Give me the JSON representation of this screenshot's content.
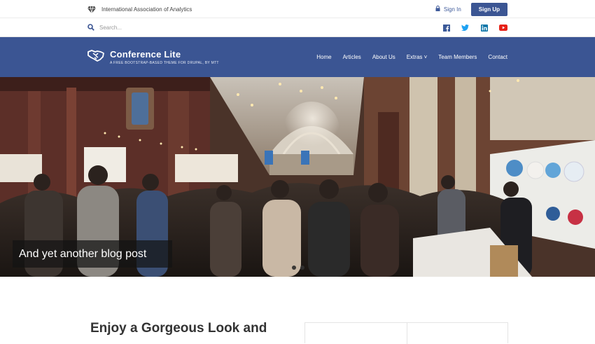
{
  "topbar": {
    "org_name": "International Association of Analytics",
    "signin_label": "Sign In",
    "signup_label": "Sign Up"
  },
  "search": {
    "placeholder": "Search..."
  },
  "social": {
    "icons": [
      "facebook-icon",
      "twitter-icon",
      "linkedin-icon",
      "youtube-icon"
    ],
    "colors": {
      "facebook": "#3b5998",
      "twitter": "#1da1f2",
      "linkedin": "#0e76a8",
      "youtube": "#e62117"
    }
  },
  "navbar": {
    "title": "Conference Lite",
    "tagline": "A FREE BOOTSTRAP-BASED THEME FOR DRUPAL, BY MTT",
    "items": [
      {
        "label": "Home"
      },
      {
        "label": "Articles"
      },
      {
        "label": "About Us"
      },
      {
        "label": "Extras ˅"
      },
      {
        "label": "Team Members"
      },
      {
        "label": "Contact"
      }
    ]
  },
  "hero": {
    "caption": "And yet another blog post",
    "slide_count": 2,
    "active_slide": 1
  },
  "content": {
    "heading": "Enjoy a Gorgeous Look and"
  },
  "colors": {
    "brand": "#3b5593",
    "accent_link": "#3e5a9a"
  }
}
